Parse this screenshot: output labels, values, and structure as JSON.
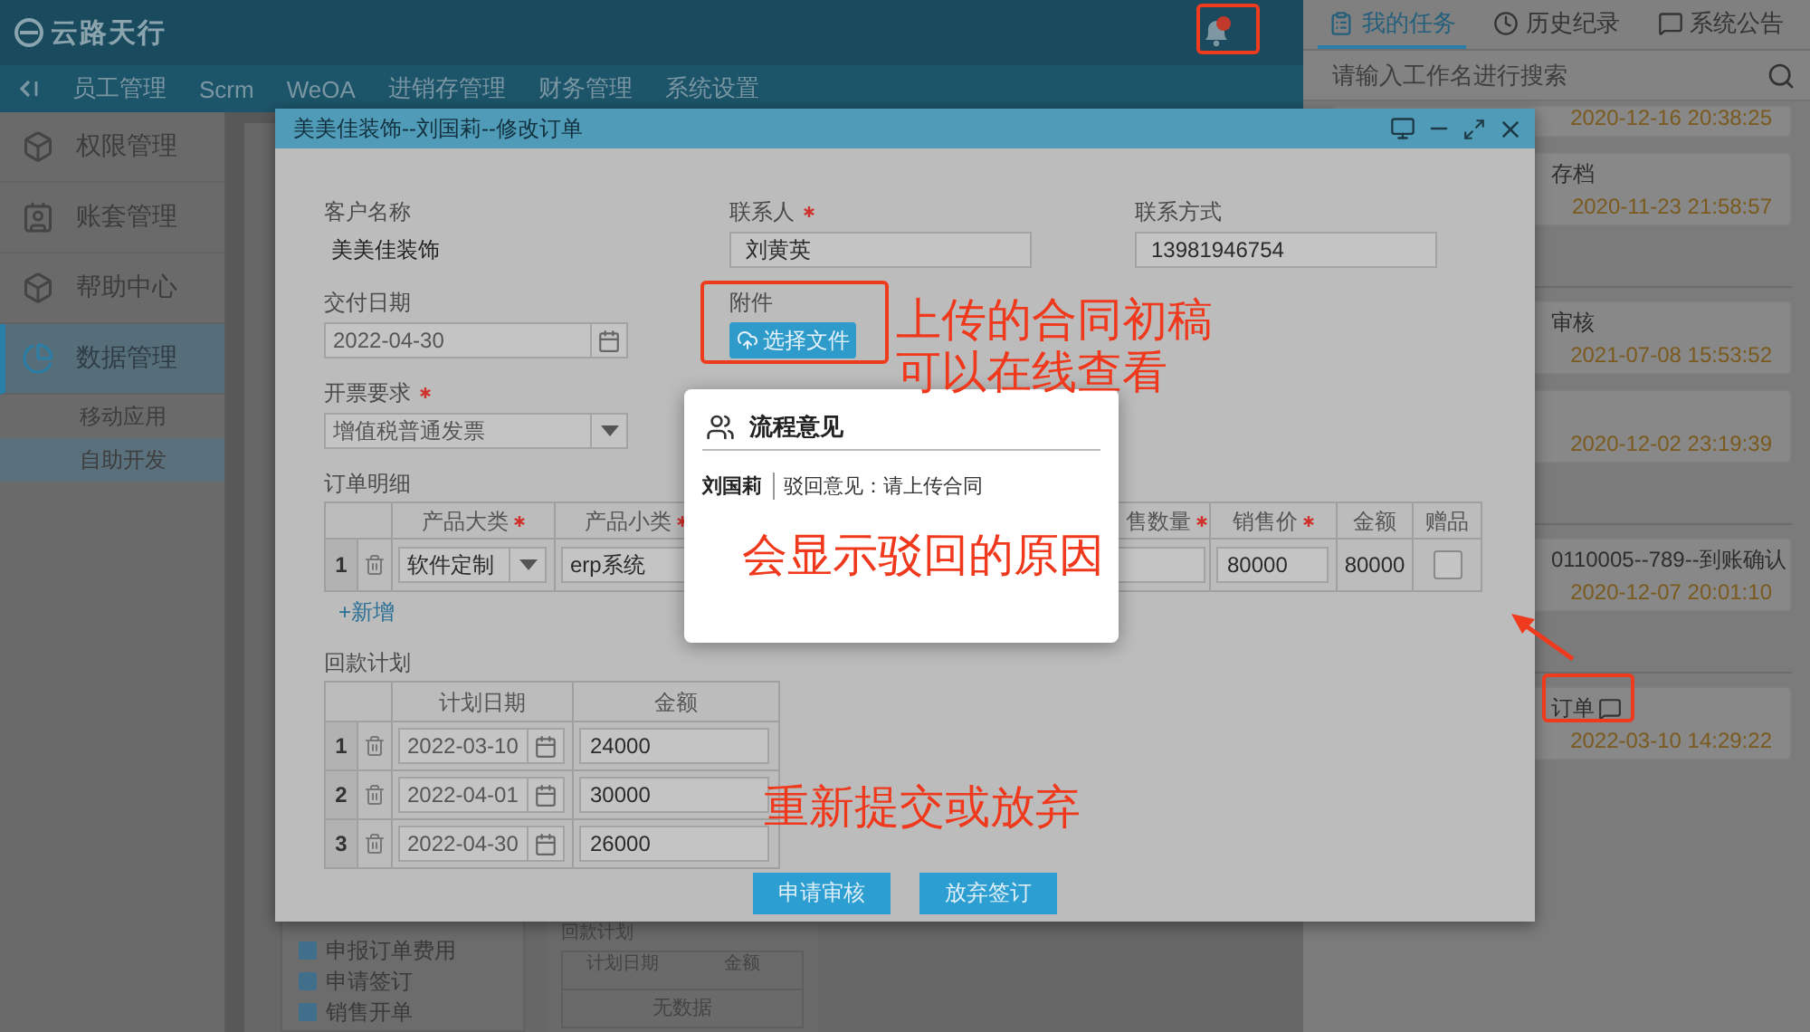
{
  "app": {
    "logo": "云路天行"
  },
  "nav": {
    "items": [
      "员工管理",
      "Scrm",
      "WeOA",
      "进销存管理",
      "财务管理",
      "系统设置"
    ]
  },
  "sidebar": {
    "items": [
      {
        "label": "权限管理",
        "selected": false
      },
      {
        "label": "账套管理",
        "selected": false
      },
      {
        "label": "帮助中心",
        "selected": false
      },
      {
        "label": "数据管理",
        "selected": true,
        "children": [
          {
            "label": "移动应用",
            "selected": false
          },
          {
            "label": "自助开发",
            "selected": true
          }
        ]
      }
    ]
  },
  "content": {
    "tree": [
      "申报订单费用",
      "申请签订",
      "销售开单"
    ],
    "plan": {
      "title": "回款计划",
      "columns": [
        "计划日期",
        "金额"
      ],
      "empty": "无数据"
    }
  },
  "task_panel": {
    "tabs": [
      {
        "label": "我的任务",
        "selected": true
      },
      {
        "label": "历史纪录",
        "selected": false
      },
      {
        "label": "系统公告",
        "selected": false
      }
    ],
    "search": {
      "placeholder": "请输入工作名进行搜索"
    },
    "groups": [
      [
        {
          "time": "2020-12-16 20:38:25",
          "comment": false
        },
        {
          "title": "存档",
          "time": "2020-11-23 21:58:57",
          "comment": false
        }
      ],
      [
        {
          "title": "审核",
          "time": "2021-07-08 15:53:52",
          "comment": false
        },
        {
          "time": "2020-12-02 23:19:39",
          "comment": false
        }
      ],
      [
        {
          "title": "0110005--789--到账确认",
          "time": "2020-12-07 20:01:10",
          "comment": false
        }
      ],
      [
        {
          "title": "订单",
          "time": "2022-03-10 14:29:22",
          "comment": true
        }
      ]
    ]
  },
  "modal": {
    "title": "美美佳装饰--刘国莉--修改订单",
    "rows": [
      [
        {
          "kind": "text",
          "label": "客户名称",
          "value": "美美佳装饰"
        },
        {
          "kind": "input",
          "label": "联系人",
          "required": true,
          "value": "刘黄英"
        },
        {
          "kind": "input",
          "label": "联系方式",
          "value": "13981946754"
        }
      ],
      [
        {
          "kind": "date",
          "label": "交付日期",
          "value": "2022-04-30"
        },
        {
          "kind": "upload",
          "label": "附件",
          "value": "选择文件"
        }
      ],
      [
        {
          "kind": "select",
          "label": "开票要求",
          "required": true,
          "value": "增值税普通发票"
        }
      ]
    ],
    "order": {
      "title": "订单明细",
      "columns": [
        {
          "label": "产品大类",
          "required": true
        },
        {
          "label": "产品小类",
          "required": true
        },
        {
          "label": "售数量",
          "required": true
        },
        {
          "label": "销售价",
          "required": true
        },
        {
          "label": "金额"
        },
        {
          "label": "赠品"
        }
      ],
      "rows": [
        {
          "index": "1",
          "category": "软件定制",
          "subcategory": "erp系统",
          "price": "80000",
          "amount": "80000",
          "gift": false
        }
      ],
      "add": "+新增"
    },
    "plan": {
      "title": "回款计划",
      "columns": [
        "计划日期",
        "金额"
      ],
      "rows": [
        {
          "index": "1",
          "date": "2022-03-10",
          "amount": "24000"
        },
        {
          "index": "2",
          "date": "2022-04-01",
          "amount": "30000"
        },
        {
          "index": "3",
          "date": "2022-04-30",
          "amount": "26000"
        }
      ]
    },
    "buttons": [
      "申请审核",
      "放弃签订"
    ]
  },
  "popup": {
    "title": "流程意见",
    "opinions": [
      {
        "name": "刘国莉",
        "text": "驳回意见：请上传合同"
      }
    ]
  },
  "annotations": [
    "上传的合同初稿可以在线查看",
    "会显示驳回的原因",
    "重新提交或放弃"
  ]
}
